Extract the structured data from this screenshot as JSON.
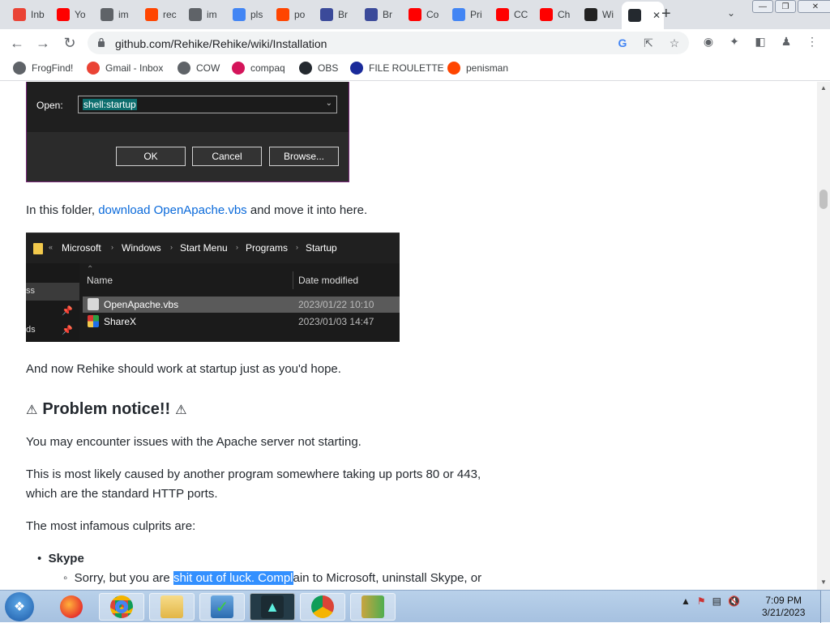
{
  "tabs": [
    {
      "title": "Inb",
      "icon": "gmail-icon",
      "color": "#ea4335"
    },
    {
      "title": "Yo",
      "icon": "youtube-icon",
      "color": "#ff0000"
    },
    {
      "title": "im",
      "icon": "globe-icon",
      "color": "#5f6368"
    },
    {
      "title": "rec",
      "icon": "reddit-icon",
      "color": "#ff4500"
    },
    {
      "title": "im",
      "icon": "globe-icon",
      "color": "#5f6368"
    },
    {
      "title": "pls",
      "icon": "google-icon",
      "color": "#4285f4"
    },
    {
      "title": "po",
      "icon": "reddit-icon",
      "color": "#ff4500"
    },
    {
      "title": "Br",
      "icon": "board-icon",
      "color": "#3b4a9a"
    },
    {
      "title": "Br",
      "icon": "board-icon",
      "color": "#3b4a9a"
    },
    {
      "title": "Co",
      "icon": "youtube-icon",
      "color": "#ff0000"
    },
    {
      "title": "Pri",
      "icon": "google-icon",
      "color": "#4285f4"
    },
    {
      "title": "CC",
      "icon": "youtube-icon",
      "color": "#ff0000"
    },
    {
      "title": "Ch",
      "icon": "youtube-icon",
      "color": "#ff0000"
    },
    {
      "title": "Wi",
      "icon": "wikipedia-icon",
      "color": "#222222"
    },
    {
      "title": "",
      "icon": "github-icon",
      "color": "#24292f"
    }
  ],
  "toolbar": {
    "url": "github.com/Rehike/Rehike/wiki/Installation"
  },
  "bookmarks": [
    {
      "label": "FrogFind!",
      "icon": "globe-icon",
      "color": "#5f6368"
    },
    {
      "label": "Gmail - Inbox",
      "icon": "gmail-icon",
      "color": "#ea4335"
    },
    {
      "label": "COW",
      "icon": "globe-icon",
      "color": "#5f6368"
    },
    {
      "label": "compaq",
      "icon": "compaq-icon",
      "color": "#d4145a"
    },
    {
      "label": "OBS",
      "icon": "github-icon",
      "color": "#24292f"
    },
    {
      "label": "FILE ROULETTE",
      "icon": "mft-icon",
      "color": "#1a2a9a"
    },
    {
      "label": "penisman",
      "icon": "reddit-icon",
      "color": "#ff4500"
    }
  ],
  "run_dialog": {
    "open_label": "Open:",
    "value": "shell:startup",
    "ok": "OK",
    "cancel": "Cancel",
    "browse": "Browse..."
  },
  "para1": {
    "before": "In this folder, ",
    "link": "download OpenApache.vbs",
    "after": " and move it into here."
  },
  "explorer": {
    "breadcrumb": [
      "Microsoft",
      "Windows",
      "Start Menu",
      "Programs",
      "Startup"
    ],
    "nav_items": [
      "ss",
      "ds"
    ],
    "col_name": "Name",
    "col_date": "Date modified",
    "files": [
      {
        "name": "OpenApache.vbs",
        "date": "2023/01/22 10:10"
      },
      {
        "name": "ShareX",
        "date": "2023/01/03 14:47"
      }
    ]
  },
  "para2": "And now Rehike should work at startup just as you'd hope.",
  "heading": "Problem notice!!",
  "para3": "You may encounter issues with the Apache server not starting.",
  "para4_line1": "This is most likely caused by another program somewhere taking up ports 80 or 443,",
  "para4_line2": "which are the standard HTTP ports.",
  "para5": "The most infamous culprits are:",
  "list": {
    "item1": "Skype",
    "sub1_before": "Sorry, but you are ",
    "sub1_highlight": "shit out of luck. Compl",
    "sub1_after": "ain to Microsoft, uninstall Skype, or"
  },
  "taskbar": {
    "time": "7:09 PM",
    "date": "3/21/2023"
  }
}
